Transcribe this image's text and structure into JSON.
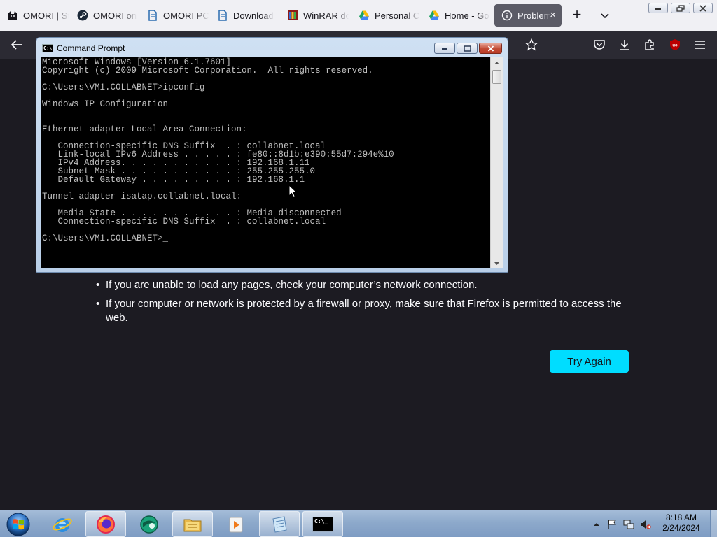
{
  "browser": {
    "tabs": [
      {
        "label": "OMORI | St",
        "icon": "cat-icon",
        "color": "#15141a"
      },
      {
        "label": "OMORI on",
        "icon": "steam-icon",
        "color": "#1b2838"
      },
      {
        "label": "OMORI PC",
        "icon": "document-icon",
        "color": "#2b6cb0"
      },
      {
        "label": "Download",
        "icon": "document-icon",
        "color": "#2b6cb0"
      },
      {
        "label": "WinRAR do",
        "icon": "winrar-icon",
        "color": "#8b1a1a"
      },
      {
        "label": "Personal C",
        "icon": "google-drive-icon",
        "color": "#1fa463"
      },
      {
        "label": "Home - Go",
        "icon": "google-drive-icon",
        "color": "#1fa463"
      },
      {
        "label": "Problem",
        "icon": "info-icon",
        "color": "#fbfbfe",
        "active": true
      }
    ],
    "new_tab_label": "+",
    "close_tab_label": "×"
  },
  "error_page": {
    "bullets": [
      "If you are unable to load any pages, check your computer’s network connection.",
      "If your computer or network is protected by a firewall or proxy, make sure that Firefox is permitted to access the web."
    ],
    "bullet_char": "•",
    "try_again_label": "Try Again",
    "accent": "#00ddff"
  },
  "cmd_window": {
    "title": "Command Prompt",
    "icon_text": "C:\\",
    "output": "Microsoft Windows [Version 6.1.7601]\nCopyright (c) 2009 Microsoft Corporation.  All rights reserved.\n\nC:\\Users\\VM1.COLLABNET>ipconfig\n\nWindows IP Configuration\n\n\nEthernet adapter Local Area Connection:\n\n   Connection-specific DNS Suffix  . : collabnet.local\n   Link-local IPv6 Address . . . . . : fe80::8d1b:e390:55d7:294e%10\n   IPv4 Address. . . . . . . . . . . : 192.168.1.11\n   Subnet Mask . . . . . . . . . . . : 255.255.255.0\n   Default Gateway . . . . . . . . . : 192.168.1.1\n\nTunnel adapter isatap.collabnet.local:\n\n   Media State . . . . . . . . . . . : Media disconnected\n   Connection-specific DNS Suffix  . : collabnet.local\n\nC:\\Users\\VM1.COLLABNET>_"
  },
  "taskbar": {
    "apps": [
      {
        "name": "internet-explorer-icon",
        "open": false
      },
      {
        "name": "firefox-icon",
        "open": true
      },
      {
        "name": "app-globe-icon",
        "open": false
      },
      {
        "name": "file-explorer-icon",
        "open": true
      },
      {
        "name": "media-player-icon",
        "open": false
      },
      {
        "name": "notepad-icon",
        "open": true
      },
      {
        "name": "command-prompt-icon",
        "open": true
      }
    ],
    "cmd_button_text": "C:\\_",
    "time": "8:18 AM",
    "date": "2/24/2024"
  }
}
